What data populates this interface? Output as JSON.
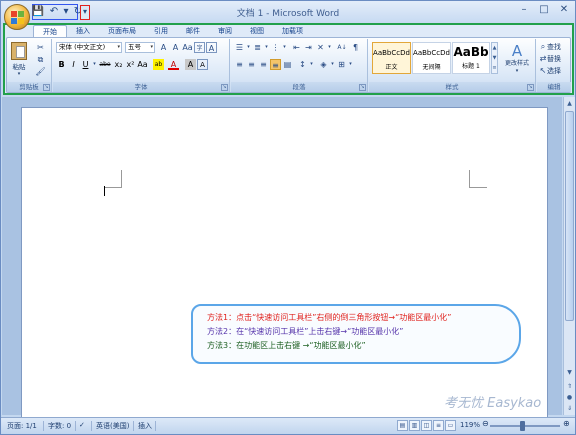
{
  "window": {
    "title": "文档 1 - Microsoft Word"
  },
  "qat": {
    "save": "💾",
    "undo": "↶",
    "undo_dd": "▾",
    "redo": "↻",
    "customize": "▾"
  },
  "controls": {
    "minimize": "–",
    "maximize": "□",
    "close": "✕"
  },
  "tabs": [
    "开始",
    "插入",
    "页面布局",
    "引用",
    "邮件",
    "审阅",
    "视图",
    "加载项"
  ],
  "clipboard": {
    "paste_label": "粘贴",
    "group_label": "剪贴板"
  },
  "font": {
    "name_value": "宋体 (中文正文)",
    "size_value": "五号",
    "row1_tail": [
      "A",
      "A",
      "Aa",
      "字",
      "A"
    ],
    "row2": [
      "B",
      "I",
      "U",
      "abe",
      "x₂",
      "x²",
      "Aa"
    ],
    "highlight": "ab",
    "color": "A",
    "group_label": "字体"
  },
  "paragraph": {
    "group_label": "段落",
    "sort": "A↓",
    "marks": "¶"
  },
  "styles": {
    "items": [
      {
        "sample": "AaBbCcDd",
        "name": "正文",
        "selected": true
      },
      {
        "sample": "AaBbCcDd",
        "name": "无间隔",
        "selected": false
      },
      {
        "sample": "AaBb",
        "name": "标题 1",
        "selected": false
      }
    ],
    "change_label": "更改样式",
    "group_label": "样式"
  },
  "editing": {
    "find": "查找",
    "replace": "替换",
    "select": "选择",
    "group_label": "编辑"
  },
  "callout": {
    "line1": "方法1：点击“快速访问工具栏”右侧的倒三角形按钮→“功能区最小化”",
    "line1_color": "#e0211d",
    "line2": "方法2：在“快速访问工具栏”上击右键→“功能区最小化”",
    "line2_color": "#5533aa",
    "line3": "方法3：在功能区上击右键 →“功能区最小化”",
    "line3_color": "#1b5e20"
  },
  "status": {
    "page": "页面: 1/1",
    "words": "字数: 0",
    "language": "英语(美国)",
    "mode": "插入",
    "zoom": "119%",
    "watermark": "考无忧 Easykao"
  }
}
